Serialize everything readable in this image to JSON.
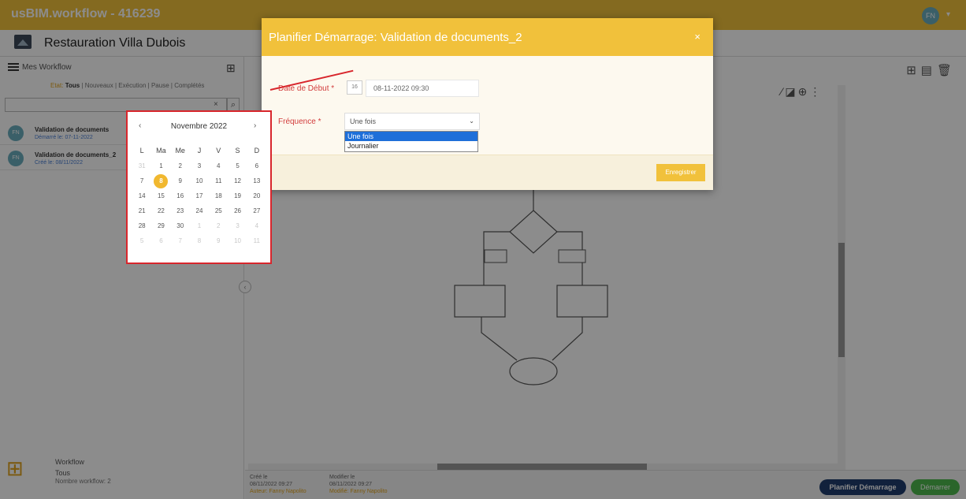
{
  "app": {
    "title": "usBIM.workflow - 416239",
    "user_initials": "FN"
  },
  "project": {
    "title": "Restauration Villa Dubois"
  },
  "left_panel": {
    "header": "Mes Workflow",
    "filters": {
      "label": "Etat:",
      "items": [
        "Tous",
        "Nouveaux",
        "Exécution",
        "Pause",
        "Complétés"
      ]
    },
    "search": {
      "value": "",
      "clear": "×"
    },
    "workflows": [
      {
        "initials": "FN",
        "name": "Validation de documents",
        "sub": "Démarré le: 07-11-2022"
      },
      {
        "initials": "FN",
        "name": "Validation de documents_2",
        "sub": "Créé le: 08/11/2022"
      }
    ],
    "footer": {
      "line1": "Workflow",
      "line2": "Tous",
      "line3": "Nombre workflow: 2"
    }
  },
  "info_bar": {
    "created_label": "Créé le",
    "created_date": "08/11/2022 09:27",
    "created_by": "Auteur: Fanny Napolito",
    "modified_label": "Modifier le",
    "modified_date": "08/11/2022 09:27",
    "modified_by": "Modifié: Fanny Napolito"
  },
  "actions": {
    "plan": "Planifier Démarrage",
    "start": "Démarrer"
  },
  "modal": {
    "title": "Planifier Démarrage: Validation de documents_2",
    "close": "×",
    "date_label": "Date de Début *",
    "date_value": "08-11-2022 09:30",
    "cal_icon_text": "16",
    "freq_label": "Fréquence *",
    "freq_selected": "Une fois",
    "freq_options": [
      "Une fois",
      "Journalier"
    ],
    "save": "Enregistrer"
  },
  "datepicker": {
    "month": "Novembre 2022",
    "weekdays": [
      "L",
      "Ma",
      "Me",
      "J",
      "V",
      "S",
      "D"
    ],
    "weeks": [
      [
        "31",
        "1",
        "2",
        "3",
        "4",
        "5",
        "6"
      ],
      [
        "7",
        "8",
        "9",
        "10",
        "11",
        "12",
        "13"
      ],
      [
        "14",
        "15",
        "16",
        "17",
        "18",
        "19",
        "20"
      ],
      [
        "21",
        "22",
        "23",
        "24",
        "25",
        "26",
        "27"
      ],
      [
        "28",
        "29",
        "30",
        "1",
        "2",
        "3",
        "4"
      ],
      [
        "5",
        "6",
        "7",
        "8",
        "9",
        "10",
        "11"
      ]
    ],
    "selected_day": "8"
  },
  "colors": {
    "accent": "#f1c13b",
    "primary": "#1f3d6e",
    "success": "#4db84d",
    "callout": "#d8262c"
  }
}
